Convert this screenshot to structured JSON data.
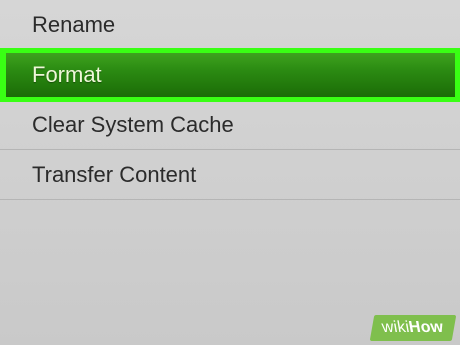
{
  "menu": {
    "items": [
      {
        "label": "Rename",
        "selected": false
      },
      {
        "label": "Format",
        "selected": true
      },
      {
        "label": "Clear System Cache",
        "selected": false
      },
      {
        "label": "Transfer Content",
        "selected": false
      }
    ]
  },
  "watermark": {
    "wiki": "wiki",
    "how": "How"
  },
  "colors": {
    "background": "#cfcfcf",
    "selected_fill": "#2b8a12",
    "selected_border": "#39ff14",
    "text": "#2b2b2b",
    "selected_text": "#eef7d8",
    "watermark_bg": "#7fbf4d"
  }
}
